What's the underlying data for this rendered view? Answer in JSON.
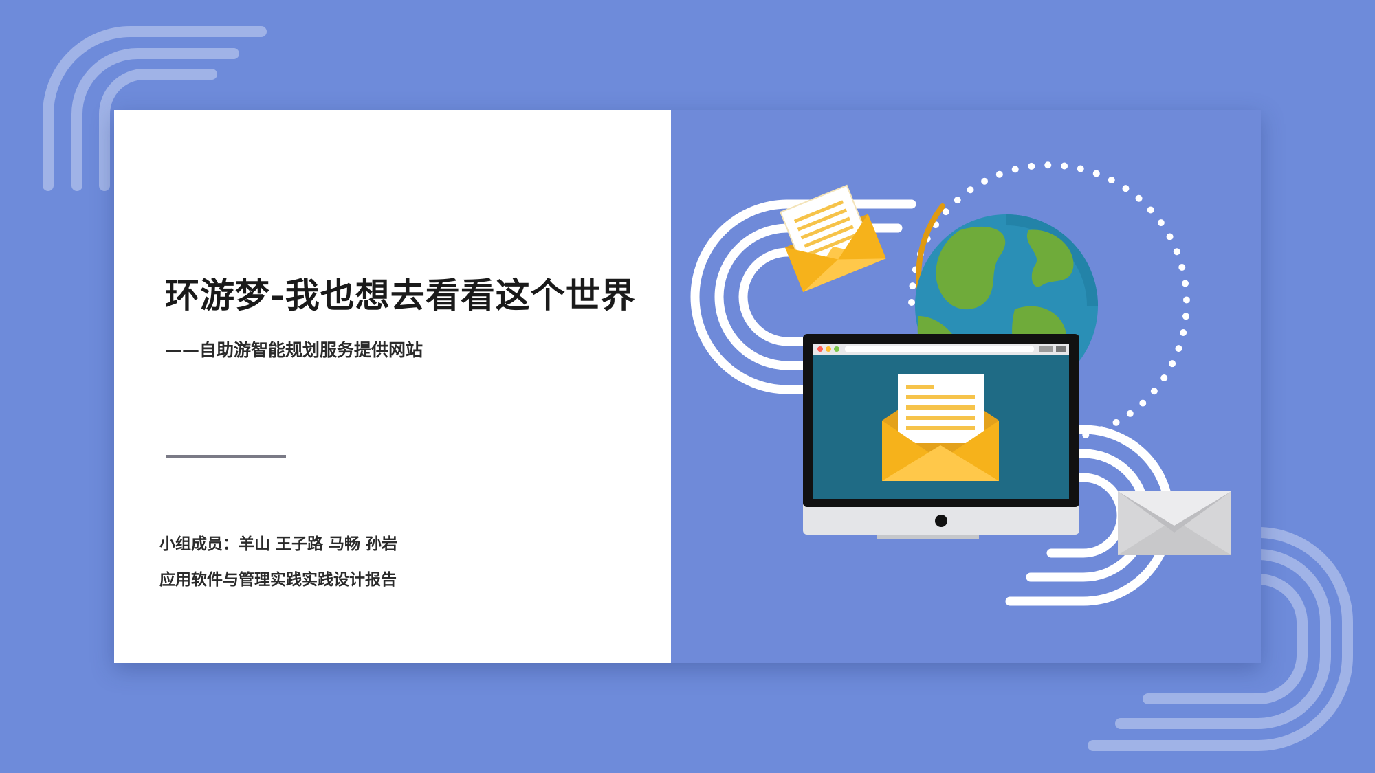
{
  "slide": {
    "title": "环游梦-我也想去看看这个世界",
    "subtitle": "——自助游智能规划服务提供网站",
    "members": "小组成员：羊山 王子路 马畅 孙岩",
    "course": "应用软件与管理实践实践设计报告"
  },
  "colors": {
    "background": "#6e8bda",
    "panel_left": "#ffffff",
    "panel_right": "#6f8ad9",
    "accent_yellow": "#f6b21b",
    "monitor_screen": "#1f6b85",
    "globe_ocean": "#2a8fb6",
    "globe_land": "#6fab3a"
  },
  "icons": {
    "globe": "globe-icon",
    "monitor": "monitor-icon",
    "mail_envelope": "envelope-icon",
    "open_mail": "open-mail-icon"
  }
}
